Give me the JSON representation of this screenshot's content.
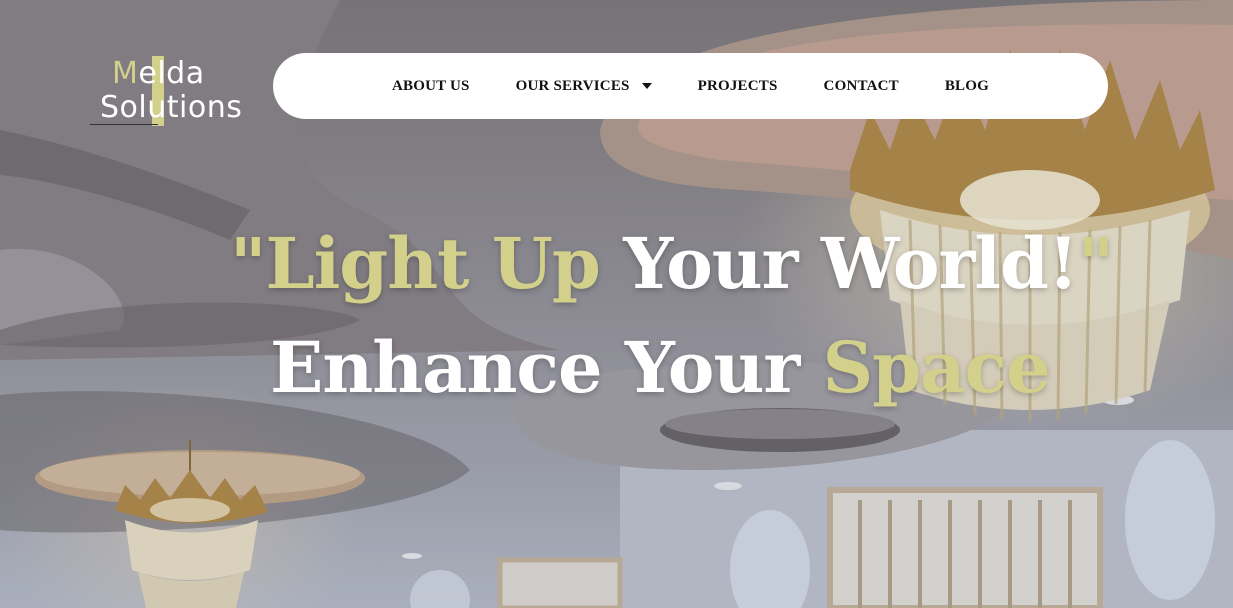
{
  "brand": {
    "logo_line1_initial": "M",
    "logo_line1_rest": "elda",
    "logo_line2": "Solutions",
    "accent_color": "#d3d08c"
  },
  "nav": {
    "items": [
      {
        "label": "ABOUT US"
      },
      {
        "label": "OUR SERVICES",
        "has_dropdown": true,
        "icon": "chevron-down-icon"
      },
      {
        "label": "PROJECTS"
      },
      {
        "label": "CONTACT"
      },
      {
        "label": "BLOG"
      }
    ]
  },
  "hero": {
    "line1_open_quote": "\"",
    "line1_highlight": "Light Up",
    "line1_rest": " Your World!",
    "line1_close_quote": "\"",
    "line2_start": "Enhance Your ",
    "line2_highlight": "Space"
  },
  "background": {
    "subject": "ceiling-with-chandeliers-photo"
  }
}
